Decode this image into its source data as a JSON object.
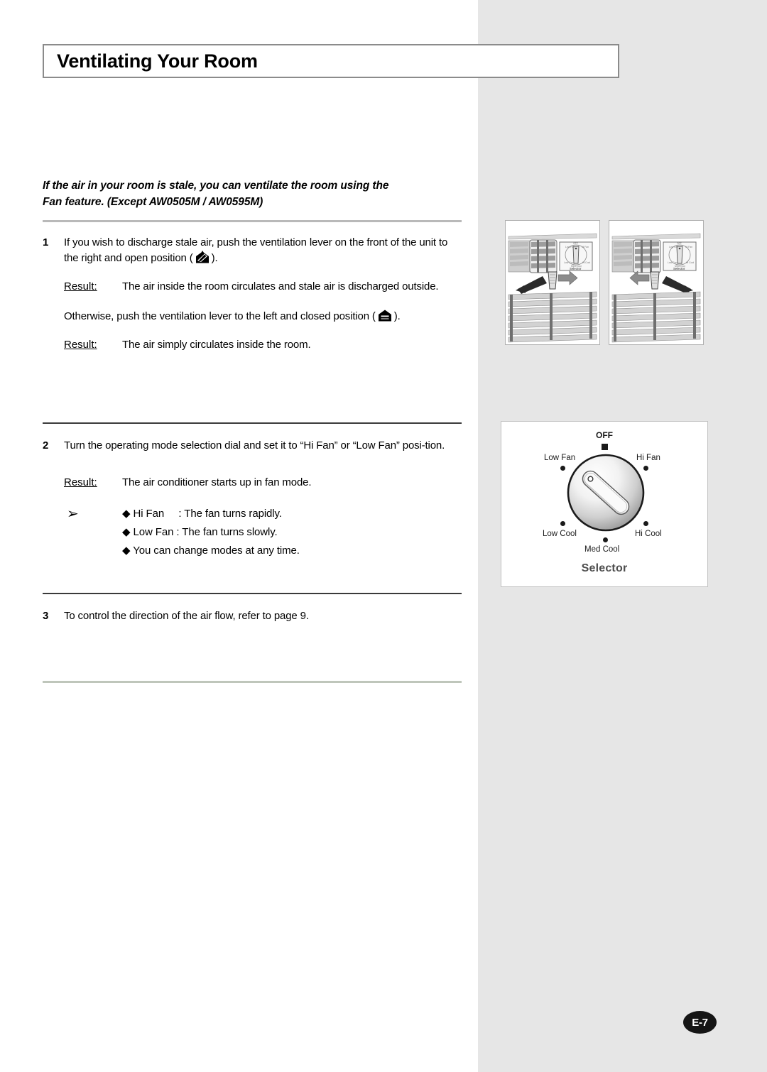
{
  "page": {
    "title": "Ventilating Your Room",
    "page_marker": "E-7",
    "sidebar_color": "#e6e6e6"
  },
  "intro": {
    "line1": "If the air in your room is stale, you can ventilate the room using the",
    "line2": "Fan feature. (Except AW0505M / AW0595M)"
  },
  "steps": [
    {
      "number": "1",
      "text_before_icon": "If you wish to discharge stale air, push the ventilation lever on the front of the unit to the right and open position (",
      "icon": "vent-open-icon",
      "text_after_icon": ").",
      "result_label": "Result:",
      "result_text": "The air inside the room circulates and stale air is discharged outside.",
      "extra_paragraph_before_icon": "Otherwise, push the ventilation lever to the left and closed position (",
      "extra_icon": "vent-closed-icon",
      "extra_paragraph_after_icon": ").",
      "result2_label": "Result:",
      "result2_text": "The air simply circulates inside the room."
    },
    {
      "number": "2",
      "text": "Turn the operating mode selection dial and set it to “Hi Fan” or “Low Fan” posi-tion.",
      "result_label": "Result:",
      "result_text": "The air conditioner starts up in fan mode.",
      "note_arrow": "➢",
      "notes": [
        "◆ Hi Fan     : The fan turns rapidly.",
        "◆ Low Fan : The fan turns slowly.",
        "◆ You can change modes at any time."
      ]
    },
    {
      "number": "3",
      "text": "To control the direction of the air flow, refer to page 9."
    }
  ],
  "illustrations": [
    {
      "name": "ac-unit-lever-open",
      "caption": ""
    },
    {
      "name": "ac-unit-lever-closed",
      "caption": ""
    }
  ],
  "selector": {
    "title": "Selector",
    "positions": [
      {
        "label": "OFF",
        "marker": "square"
      },
      {
        "label": "Low Fan",
        "marker": "dot"
      },
      {
        "label": "Hi Fan",
        "marker": "dot"
      },
      {
        "label": "Low Cool",
        "marker": "dot"
      },
      {
        "label": "Hi Cool",
        "marker": "dot"
      },
      {
        "label": "Med Cool",
        "marker": "dot"
      }
    ]
  }
}
